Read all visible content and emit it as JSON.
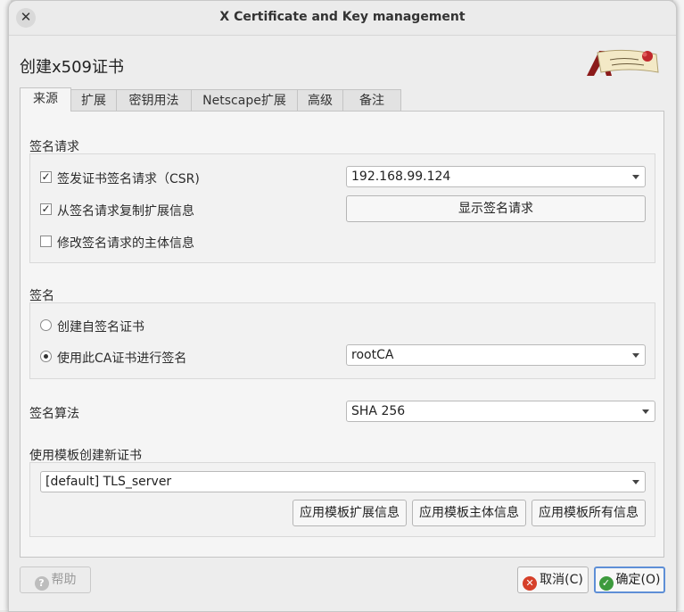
{
  "window": {
    "title": "X Certificate and Key management"
  },
  "heading": "创建x509证书",
  "tabs": [
    {
      "label": "来源",
      "active": true
    },
    {
      "label": "扩展"
    },
    {
      "label": "密钥用法"
    },
    {
      "label": "Netscape扩展"
    },
    {
      "label": "高级"
    },
    {
      "label": "备注"
    }
  ],
  "signing_request": {
    "section_label": "签名请求",
    "issue_csr": {
      "label": "签发证书签名请求（CSR)",
      "checked": true
    },
    "copy_extensions": {
      "label": "从签名请求复制扩展信息",
      "checked": true
    },
    "modify_subject": {
      "label": "修改签名请求的主体信息",
      "checked": false
    },
    "csr_select": "192.168.99.124",
    "show_request_button": "显示签名请求"
  },
  "signing": {
    "section_label": "签名",
    "self_signed": {
      "label": "创建自签名证书",
      "selected": false
    },
    "use_ca": {
      "label": "使用此CA证书进行签名",
      "selected": true
    },
    "ca_select": "rootCA"
  },
  "algorithm": {
    "label": "签名算法",
    "value": "SHA 256"
  },
  "template": {
    "section_label": "使用模板创建新证书",
    "select": "[default] TLS_server",
    "apply_extensions_button": "应用模板扩展信息",
    "apply_subject_button": "应用模板主体信息",
    "apply_all_button": "应用模板所有信息"
  },
  "footer": {
    "help_button": "帮助",
    "cancel_button": "取消(C)",
    "ok_button": "确定(O)"
  },
  "icons": {
    "close": "close-icon",
    "help": "help-icon",
    "cancel": "cancel-icon",
    "ok": "checkmark-icon"
  },
  "colors": {
    "cancel_icon": "#d6402a",
    "ok_icon": "#3d9a3d",
    "ok_focus_border": "#5e8fd6"
  }
}
